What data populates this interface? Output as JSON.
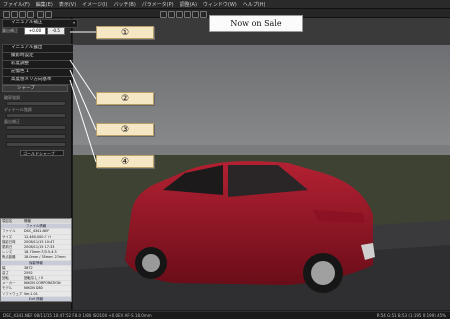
{
  "menubar": {
    "items": [
      "ファイル(F)",
      "編集(E)",
      "表示(V)",
      "イメージ(I)",
      "バッチ(B)",
      "パラメータ(P)",
      "調整(A)",
      "ウィンドウ(W)",
      "ヘルプ(H)"
    ]
  },
  "left_panel": {
    "preset": "マニュアル補正",
    "exposure_label": "露出補正",
    "exposure_value": "+0.00",
    "exposure_btn": "-0.5",
    "rows": [
      "マニュアル露出",
      "撮影時設定",
      "彩度調整",
      "記憶色 1",
      "高度感メリ方向基準"
    ],
    "sharpness_tab": "シャープ",
    "slider_labels": [
      "輪郭強調",
      "ディテール強調",
      "露出補正",
      "",
      ""
    ],
    "filter_select": "ゴールドシャープ"
  },
  "info_panel": {
    "header": [
      "項目名",
      "情報"
    ],
    "rows": [
      {
        "section": "ファイル情報"
      },
      {
        "k": "ファイル",
        "v": "DSC_4341.NEF"
      },
      {
        "k": "サイズ",
        "v": "12,480,000 ﾊﾞｲﾄ"
      },
      {
        "k": "撮影日時",
        "v": "2008/11/15 10:47"
      },
      {
        "k": "更新日",
        "v": "2008/11/15 17:33"
      },
      {
        "k": "レンズ",
        "v": "18-70mm F/3.5-4.5"
      },
      {
        "k": "焦点距離",
        "v": "18.0mm / 35mm: 27mm"
      },
      {
        "section": "撮影情報"
      },
      {
        "k": "幅",
        "v": "3872"
      },
      {
        "k": "高さ",
        "v": "2592"
      },
      {
        "k": "回転",
        "v": "回転なし / 0"
      },
      {
        "k": "メーカー",
        "v": "NIKON CORPORATION"
      },
      {
        "k": "モデル",
        "v": "NIKON D80"
      },
      {
        "k": "ソフトウェア",
        "v": "Ver.1.01"
      },
      {
        "section": "Exif 情報"
      },
      {
        "k": "ファイル",
        "v": "sRGB"
      },
      {
        "k": "カラー",
        "v": "-"
      },
      {
        "k": "撮影日時",
        "v": "2008/11/15 10:47:52"
      },
      {
        "k": "Exifバージョン",
        "v": "0221"
      },
      {
        "k": "ExifPixelX",
        "v": "3872"
      },
      {
        "k": "ExifPixelY",
        "v": "2592"
      }
    ]
  },
  "callouts": [
    "①",
    "②",
    "③",
    "④"
  ],
  "sale_label": "Now on Sale",
  "status": {
    "left": "DSC_4341.NEF  08/11/15 10:47:52  F8.0  1/80  ISO100  +0.0EV  AF-S  18.0mm",
    "right": "R:54  G:51  B:53  (1:195  0:199)  45%"
  },
  "colors": {
    "accent": "#b89f6a",
    "callout_bg": "#f5e6c4",
    "car": "#a01828"
  },
  "icons": [
    "file-open-icon",
    "save-icon",
    "undo-icon",
    "redo-icon",
    "zoom-icon",
    "rotate-icon",
    "compare-icon",
    "histogram-icon",
    "grid-icon",
    "info-icon",
    "settings-icon",
    "help-icon"
  ]
}
